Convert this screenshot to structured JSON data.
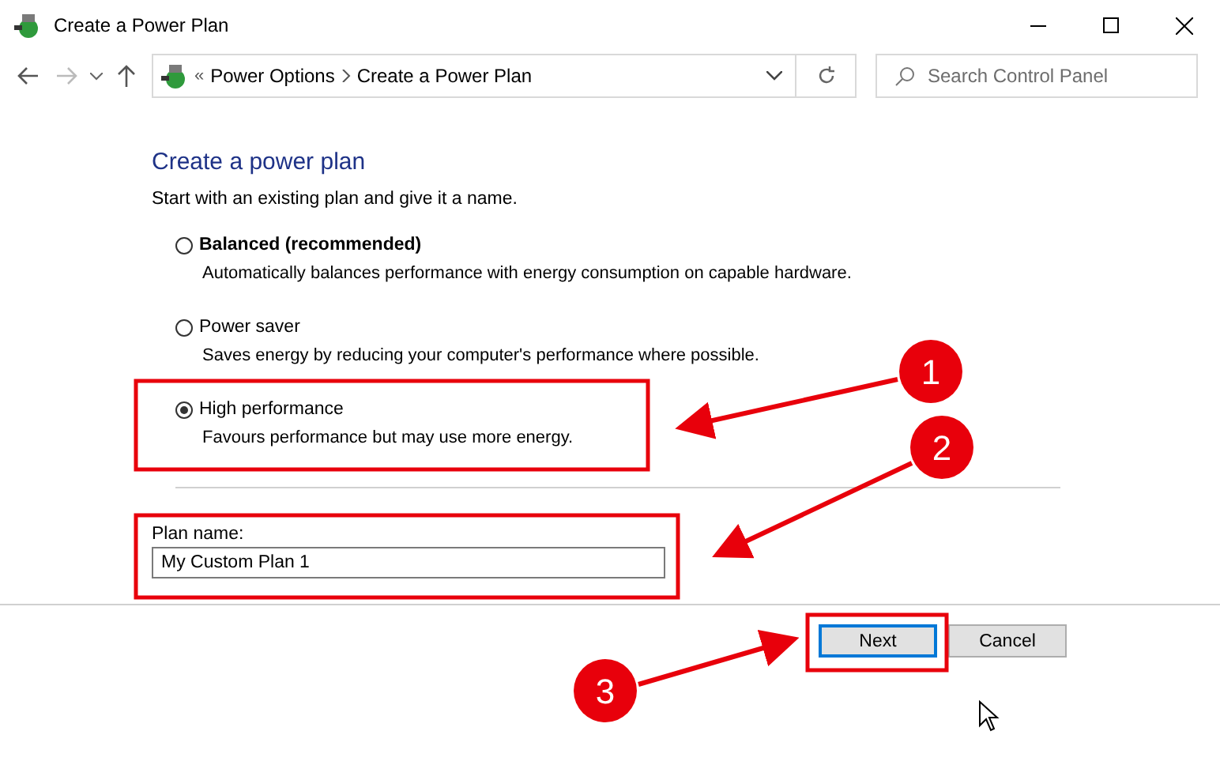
{
  "window": {
    "title": "Create a Power Plan"
  },
  "address_bar": {
    "root_marker": "«",
    "breadcrumbs": [
      "Power Options",
      "Create a Power Plan"
    ]
  },
  "search": {
    "placeholder": "Search Control Panel"
  },
  "heading": "Create a power plan",
  "intro": "Start with an existing plan and give it a name.",
  "plans": [
    {
      "name": "Balanced (recommended)",
      "description": "Automatically balances performance with energy consumption on capable hardware.",
      "bold": true,
      "selected": false
    },
    {
      "name": "Power saver",
      "description": "Saves energy by reducing your computer's performance where possible.",
      "bold": false,
      "selected": false
    },
    {
      "name": "High performance",
      "description": "Favours performance but may use more energy.",
      "bold": false,
      "selected": true
    }
  ],
  "plan_name": {
    "label": "Plan name:",
    "value": "My Custom Plan 1"
  },
  "buttons": [
    {
      "label": "Next",
      "default": true
    },
    {
      "label": "Cancel",
      "default": false
    }
  ],
  "annotations": [
    {
      "label": "1"
    },
    {
      "label": "2"
    },
    {
      "label": "3"
    }
  ]
}
